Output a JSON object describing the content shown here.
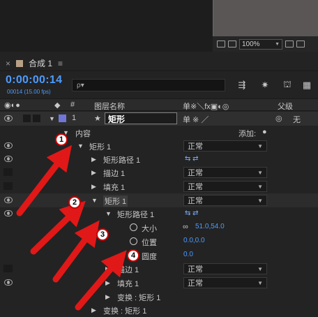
{
  "viewer": {
    "zoom": "100%"
  },
  "panel": {
    "close": "×",
    "tab_label": "合成 1",
    "menu": "≡"
  },
  "time": {
    "timecode": "0:00:00:14",
    "frames": "00014 (15.00 fps)",
    "search_placeholder": "ρ▾"
  },
  "header": {
    "layer_name_col": "图层名称",
    "switches": "单※＼fx▣◐◎",
    "parent_col": "父级",
    "num": "#"
  },
  "layer": {
    "num": "1",
    "name": "矩形",
    "parent_value": "无"
  },
  "rows": {
    "contents": "内容",
    "add": "添加:",
    "rect1": "矩形 1",
    "rect_path1": "矩形路径 1",
    "stroke1": "描边 1",
    "fill1": "填充 1",
    "rect1_inner": "矩形 1",
    "rect_path1_inner": "矩形路径 1",
    "size": "大小",
    "size_val": "51.0,54.0",
    "position": "位置",
    "position_val": "0.0,0.0",
    "roundness": "圆度",
    "roundness_val": "0.0",
    "stroke1_inner": "描边 1",
    "fill1_inner": "填充 1",
    "transform_inner": "变换 : 矩形 1",
    "transform_outer": "变换 : 矩形 1"
  },
  "blend": {
    "normal": "正常"
  },
  "annotations": {
    "b1": "1",
    "b2": "2",
    "b3": "3",
    "b4": "4"
  }
}
